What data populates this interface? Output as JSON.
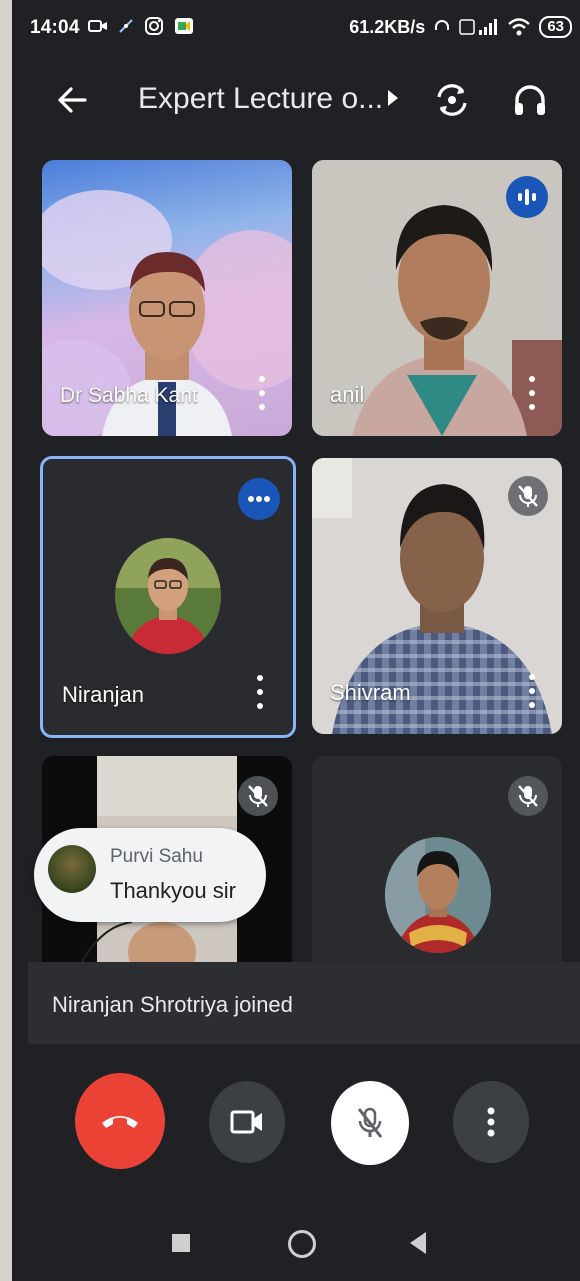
{
  "status_bar": {
    "time": "14:04",
    "network_speed": "61.2KB/s",
    "battery": "63"
  },
  "header": {
    "title": "Expert Lecture o..."
  },
  "tiles": [
    {
      "name": "Dr Sabha Kant",
      "state": "video"
    },
    {
      "name": "anil",
      "state": "speaking"
    },
    {
      "name": "Niranjan",
      "state": "active-speaker"
    },
    {
      "name": "Shivram",
      "state": "muted"
    },
    {
      "name": "",
      "state": "muted"
    },
    {
      "name": "",
      "state": "muted"
    }
  ],
  "chat": {
    "sender": "Purvi Sahu",
    "message": "Thankyou sir"
  },
  "notice": {
    "text": "Niranjan Shrotriya joined"
  },
  "colors": {
    "background": "#202124",
    "end_call": "#ea4335",
    "speaking_badge": "#1a56b8",
    "active_border": "#8ab4f8"
  },
  "icons": {
    "back": "arrow-left-icon",
    "switch_camera": "switch-camera-icon",
    "audio": "headphones-icon",
    "end_call": "phone-hangup-icon",
    "camera": "video-camera-icon",
    "mic": "mic-off-icon",
    "more": "more-vertical-icon"
  }
}
